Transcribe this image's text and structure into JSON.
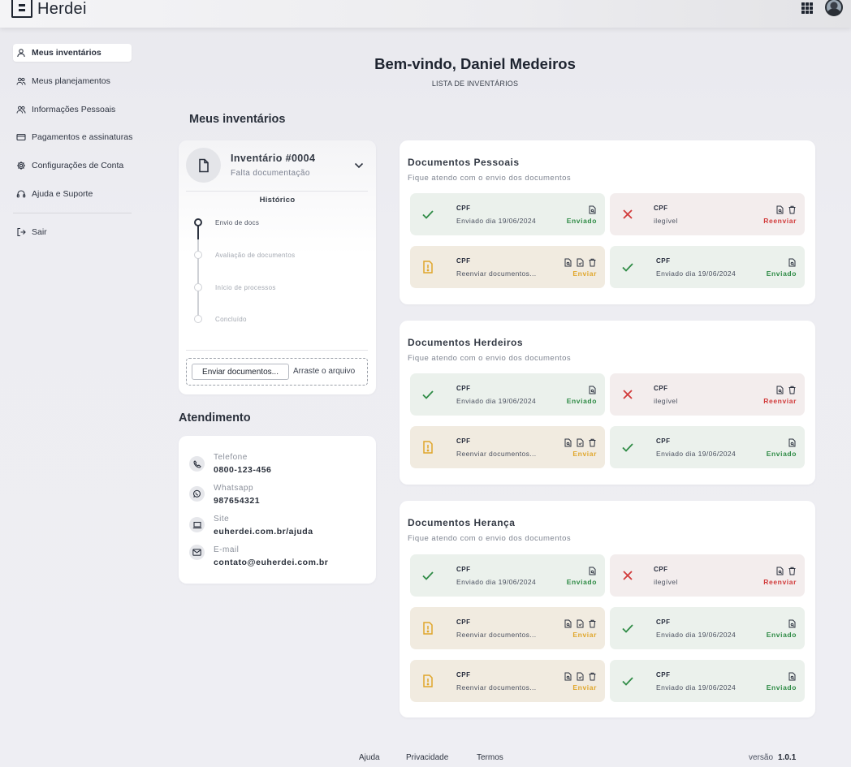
{
  "app": {
    "logo_text": "Herdei"
  },
  "sidebar": {
    "items": [
      {
        "label": "Meus inventários",
        "icon": "user-icon"
      },
      {
        "label": "Meus planejamentos",
        "icon": "users-icon"
      },
      {
        "label": "Informações Pessoais",
        "icon": "users-icon"
      },
      {
        "label": "Pagamentos e assinaturas",
        "icon": "credit-card-icon"
      },
      {
        "label": "Configurações de Conta",
        "icon": "gear-icon"
      },
      {
        "label": "Ajuda e Suporte",
        "icon": "headset-icon"
      }
    ],
    "logout_label": "Sair"
  },
  "header": {
    "welcome": "Bem-vindo, Daniel Medeiros",
    "subtitle": "LISTA DE INVENTÁRIOS"
  },
  "inventory": {
    "section_title": "Meus inventários",
    "title": "Inventário #0004",
    "status": "Falta documentação",
    "history_title": "Histórico",
    "steps": [
      "Envio de docs",
      "Avaliação de documentos",
      "Início de processos",
      "Concluído"
    ],
    "upload_button": "Enviar documentos...",
    "upload_hint": "Arraste o arquivo"
  },
  "attendance": {
    "section_title": "Atendimento",
    "contacts": [
      {
        "label": "Telefone",
        "value": "0800-123-456"
      },
      {
        "label": "Whatsapp",
        "value": "987654321"
      },
      {
        "label": "Site",
        "value": "euherdei.com.br/ajuda"
      },
      {
        "label": "E-mail",
        "value": "contato@euherdei.com.br"
      }
    ]
  },
  "doc_sections": [
    {
      "title": "Documentos Pessoais",
      "subtitle": "Fique atendo com o envio dos documentos",
      "tiles": [
        {
          "status": "ok",
          "name": "CPF",
          "desc": "Enviado dia 19/06/2024",
          "action": "Enviado"
        },
        {
          "status": "err",
          "name": "CPF",
          "desc": "ilegível",
          "action": "Reenviar"
        },
        {
          "status": "warn",
          "name": "CPF",
          "desc": "Reenviar documentos...",
          "action": "Enviar"
        },
        {
          "status": "ok",
          "name": "CPF",
          "desc": "Enviado dia 19/06/2024",
          "action": "Enviado"
        }
      ]
    },
    {
      "title": "Documentos Herdeiros",
      "subtitle": "Fique atendo com o envio dos documentos",
      "tiles": [
        {
          "status": "ok",
          "name": "CPF",
          "desc": "Enviado dia 19/06/2024",
          "action": "Enviado"
        },
        {
          "status": "err",
          "name": "CPF",
          "desc": "ilegível",
          "action": "Reenviar"
        },
        {
          "status": "warn",
          "name": "CPF",
          "desc": "Reenviar documentos...",
          "action": "Enviar"
        },
        {
          "status": "ok",
          "name": "CPF",
          "desc": "Enviado dia 19/06/2024",
          "action": "Enviado"
        }
      ]
    },
    {
      "title": "Documentos Herança",
      "subtitle": "Fique atendo com o envio dos documentos",
      "tiles": [
        {
          "status": "ok",
          "name": "CPF",
          "desc": "Enviado dia 19/06/2024",
          "action": "Enviado"
        },
        {
          "status": "err",
          "name": "CPF",
          "desc": "ilegível",
          "action": "Reenviar"
        },
        {
          "status": "warn",
          "name": "CPF",
          "desc": "Reenviar documentos...",
          "action": "Enviar"
        },
        {
          "status": "ok",
          "name": "CPF",
          "desc": "Enviado dia 19/06/2024",
          "action": "Enviado"
        },
        {
          "status": "warn",
          "name": "CPF",
          "desc": "Reenviar documentos...",
          "action": "Enviar"
        },
        {
          "status": "ok",
          "name": "CPF",
          "desc": "Enviado dia 19/06/2024",
          "action": "Enviado"
        }
      ]
    }
  ],
  "footer": {
    "links": [
      "Ajuda",
      "Privacidade",
      "Termos"
    ],
    "version_label": "versão",
    "version": "1.0.1"
  },
  "colors": {
    "ok": "#2e8b45",
    "error": "#d13a3a",
    "warning": "#e0a62a"
  }
}
